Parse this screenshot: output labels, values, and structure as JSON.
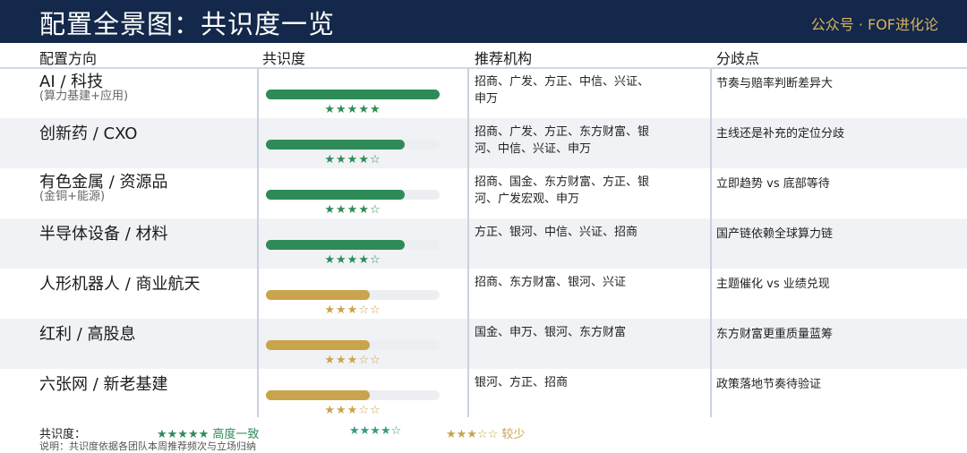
{
  "header": {
    "title": "配置全景图：共识度一览",
    "brand": "公众号 · FOF进化论"
  },
  "columns": {
    "direction": "配置方向",
    "consensus": "共识度",
    "institutions": "推荐机构",
    "divergence": "分歧点"
  },
  "colors": {
    "header_bg": "#13284a",
    "brand": "#d9b25e",
    "green": "#2e8b57",
    "gold": "#c9a44c"
  },
  "rows": [
    {
      "name": "AI / 科技",
      "sub": "(算力基建+应用)",
      "consensus_fraction": 1.0,
      "level": "high",
      "stars": "★★★★★",
      "institutions": "招商、广发、方正、中信、兴证、申万",
      "divergence": "节奏与赔率判断差异大"
    },
    {
      "name": "创新药 / CXO",
      "sub": "",
      "consensus_fraction": 0.8,
      "level": "high",
      "stars": "★★★★☆",
      "institutions": "招商、广发、方正、东方财富、银河、中信、兴证、申万",
      "divergence": "主线还是补充的定位分歧"
    },
    {
      "name": "有色金属 / 资源品",
      "sub": "(金铜+能源)",
      "consensus_fraction": 0.8,
      "level": "high",
      "stars": "★★★★☆",
      "institutions": "招商、国金、东方财富、方正、银河、广发宏观、申万",
      "divergence": "立即趋势 vs 底部等待"
    },
    {
      "name": "半导体设备 / 材料",
      "sub": "",
      "consensus_fraction": 0.8,
      "level": "high",
      "stars": "★★★★☆",
      "institutions": "方正、银河、中信、兴证、招商",
      "divergence": "国产链依赖全球算力链"
    },
    {
      "name": "人形机器人 / 商业航天",
      "sub": "",
      "consensus_fraction": 0.6,
      "level": "low",
      "stars": "★★★☆☆",
      "institutions": "招商、东方财富、银河、兴证",
      "divergence": "主题催化 vs 业绩兑现"
    },
    {
      "name": "红利 / 高股息",
      "sub": "",
      "consensus_fraction": 0.6,
      "level": "low",
      "stars": "★★★☆☆",
      "institutions": "国金、申万、银河、东方财富",
      "divergence": "东方财富更重质量蓝筹"
    },
    {
      "name": "六张网 / 新老基建",
      "sub": "",
      "consensus_fraction": 0.6,
      "level": "low",
      "stars": "★★★☆☆",
      "institutions": "银河、方正、招商",
      "divergence": "政策落地节奏待验证"
    }
  ],
  "legend": {
    "label": "共识度：",
    "high": "★★★★★ 高度一致",
    "mid": "★★★★☆",
    "low": "★★★☆☆ 较少"
  },
  "note": "说明：共识度依据各团队本周推荐频次与立场归纳"
}
